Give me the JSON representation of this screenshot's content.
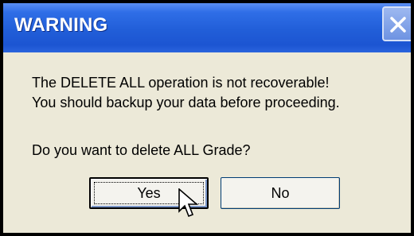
{
  "dialog": {
    "title": "WARNING",
    "close_icon": "close-icon",
    "message_line1": "The DELETE ALL operation is not recoverable!",
    "message_line2": "You should backup your data before proceeding.",
    "question": "Do you want to delete ALL Grade?"
  },
  "buttons": {
    "yes_label": "Yes",
    "no_label": "No"
  },
  "cursor": "mouse-pointer-icon",
  "colors": {
    "titlebar": "#215ed8",
    "client_background": "#ece9d8",
    "title_text": "#ffffff"
  }
}
